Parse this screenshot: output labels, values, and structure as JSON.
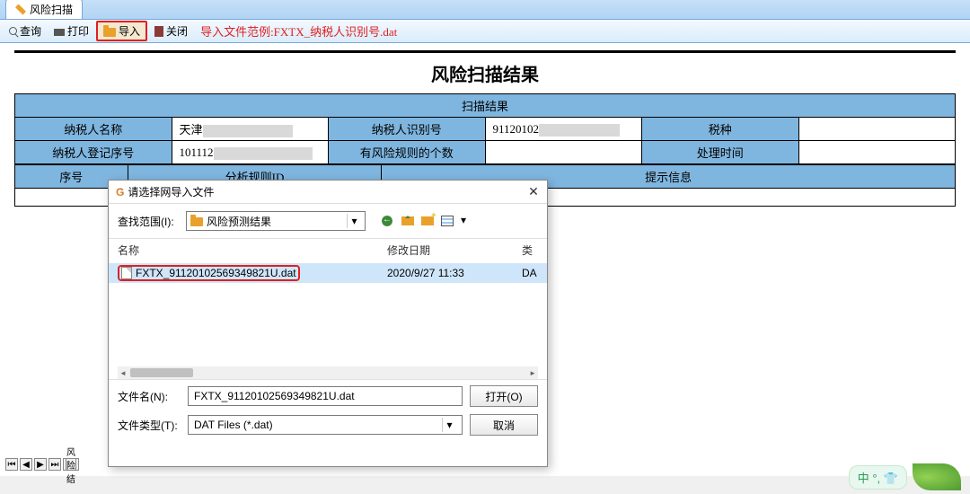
{
  "tab": {
    "title": "风险扫描"
  },
  "toolbar": {
    "search_label": "查询",
    "print_label": "打印",
    "import_label": "导入",
    "close_label": "关闭",
    "tip": "导入文件范例:FXTX_纳税人识别号.dat"
  },
  "result": {
    "title": "风险扫描结果",
    "subheader": "扫描结果",
    "labels": {
      "taxpayer_name": "纳税人名称",
      "taxpayer_id": "纳税人识别号",
      "tax_type": "税种",
      "reg_no": "纳税人登记序号",
      "risk_count": "有风险规则的个数",
      "proc_time": "处理时间",
      "seq": "序号",
      "rule_id": "分析规则ID",
      "info": "提示信息"
    },
    "values": {
      "taxpayer_name": "天津",
      "taxpayer_id": "91120102",
      "reg_no": "101112",
      "tax_type": "",
      "risk_count": "",
      "proc_time": ""
    }
  },
  "dialog": {
    "title": "请选择网导入文件",
    "lookin_label": "查找范围(I):",
    "lookin_value": "风险预测结果",
    "columns": {
      "name": "名称",
      "modified": "修改日期",
      "type": "类"
    },
    "file": {
      "name": "FXTX_91120102569349821U.dat",
      "modified": "2020/9/27 11:33",
      "type": "DA"
    },
    "filename_label": "文件名(N):",
    "filename_value": "FXTX_91120102569349821U.dat",
    "filetype_label": "文件类型(T):",
    "filetype_value": "DAT Files (*.dat)",
    "open_btn": "打开(O)",
    "cancel_btn": "取消"
  },
  "nav": {
    "tab_label": "风险结"
  },
  "ime": {
    "text": "中 °,"
  }
}
